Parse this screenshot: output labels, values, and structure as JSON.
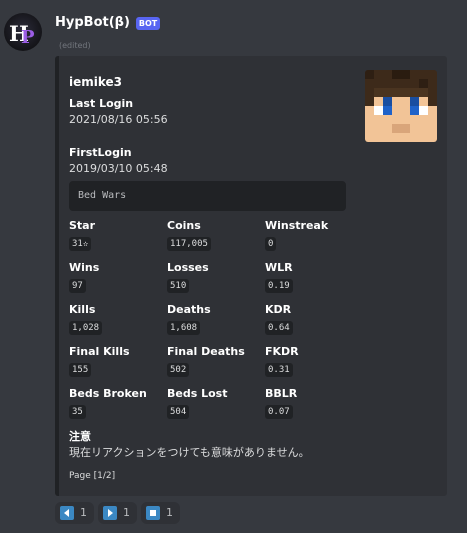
{
  "message": {
    "author": "HypBot(β)",
    "badge": "BOT",
    "edited": "(edited)"
  },
  "embed": {
    "title": "iemike3",
    "last_login": {
      "name": "Last Login",
      "value": "2021/08/16 05:56"
    },
    "first_login": {
      "name": "FirstLogin",
      "value": "2019/03/10 05:48"
    },
    "game_mode": "Bed Wars",
    "stats": [
      {
        "name": "Star",
        "value": "31✫"
      },
      {
        "name": "Coins",
        "value": "117,005"
      },
      {
        "name": "Winstreak",
        "value": "0"
      },
      {
        "name": "Wins",
        "value": "97"
      },
      {
        "name": "Losses",
        "value": "510"
      },
      {
        "name": "WLR",
        "value": "0.19"
      },
      {
        "name": "Kills",
        "value": "1,028"
      },
      {
        "name": "Deaths",
        "value": "1,608"
      },
      {
        "name": "KDR",
        "value": "0.64"
      },
      {
        "name": "Final Kills",
        "value": "155"
      },
      {
        "name": "Final Deaths",
        "value": "502"
      },
      {
        "name": "FKDR",
        "value": "0.31"
      },
      {
        "name": "Beds Broken",
        "value": "35"
      },
      {
        "name": "Beds Lost",
        "value": "504"
      },
      {
        "name": "BBLR",
        "value": "0.07"
      }
    ],
    "note_title": "注意",
    "note_text": "現在リアクションをつけても意味がありません。",
    "footer": "Page [1/2]"
  },
  "reactions": [
    {
      "icon": "arrow-left-icon",
      "count": "1"
    },
    {
      "icon": "arrow-right-icon",
      "count": "1"
    },
    {
      "icon": "stop-square-icon",
      "count": "1"
    }
  ],
  "colors": {
    "background": "#36393f",
    "embed_bg": "#2f3136",
    "code_bg": "#202225",
    "badge": "#5865f2",
    "reaction_emoji": "#3b88c3"
  }
}
